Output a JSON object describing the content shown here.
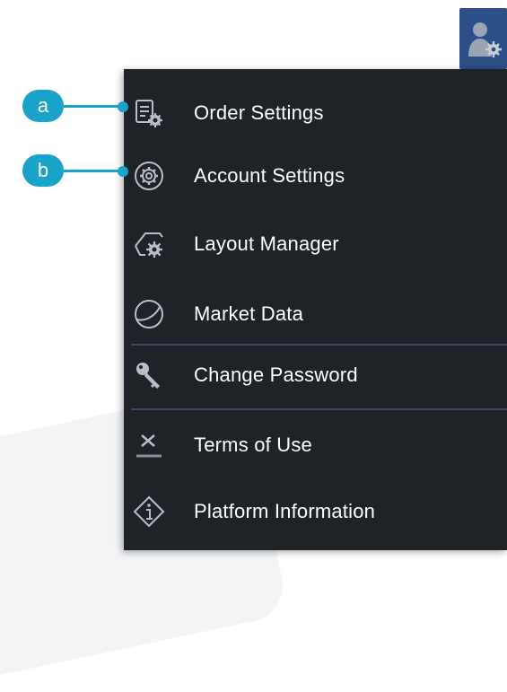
{
  "colors": {
    "accent": "#1aa3c9",
    "menu_bg": "#1f2226",
    "user_button_bg": "#2b4f86"
  },
  "user_button": {
    "icon": "user-settings-icon"
  },
  "callouts": [
    {
      "label": "a",
      "target": "order-settings-icon"
    },
    {
      "label": "b",
      "target": "account-settings-icon"
    }
  ],
  "menu": {
    "items": [
      {
        "label": "Order Settings",
        "icon": "order-settings-icon"
      },
      {
        "label": "Account Settings",
        "icon": "account-settings-icon"
      },
      {
        "label": "Layout Manager",
        "icon": "layout-manager-icon"
      },
      {
        "label": "Market Data",
        "icon": "market-data-icon"
      },
      {
        "label": "Change Password",
        "icon": "key-icon"
      },
      {
        "label": "Terms of Use",
        "icon": "terms-of-use-icon"
      },
      {
        "label": "Platform Information",
        "icon": "info-icon"
      }
    ]
  }
}
